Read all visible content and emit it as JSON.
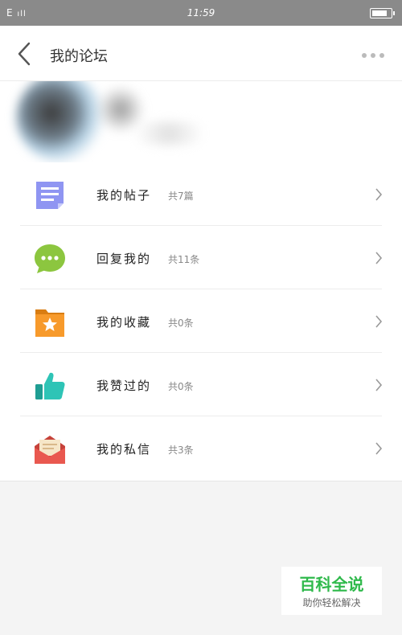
{
  "status_bar": {
    "signal": "E",
    "time": "11:59"
  },
  "nav": {
    "title": "我的论坛"
  },
  "menu": [
    {
      "label": "我的帖子",
      "count": "共7篇",
      "icon": "document-icon",
      "color": "#8f95f2"
    },
    {
      "label": "回复我的",
      "count": "共11条",
      "icon": "chat-bubble-icon",
      "color": "#8cc63f"
    },
    {
      "label": "我的收藏",
      "count": "共0条",
      "icon": "star-folder-icon",
      "color": "#f79a2b"
    },
    {
      "label": "我赞过的",
      "count": "共0条",
      "icon": "thumbs-up-icon",
      "color": "#2ec4b6"
    },
    {
      "label": "我的私信",
      "count": "共3条",
      "icon": "envelope-icon",
      "color": "#e9584f"
    }
  ],
  "watermark": {
    "brand": "百科全说",
    "slogan": "助你轻松解决"
  }
}
